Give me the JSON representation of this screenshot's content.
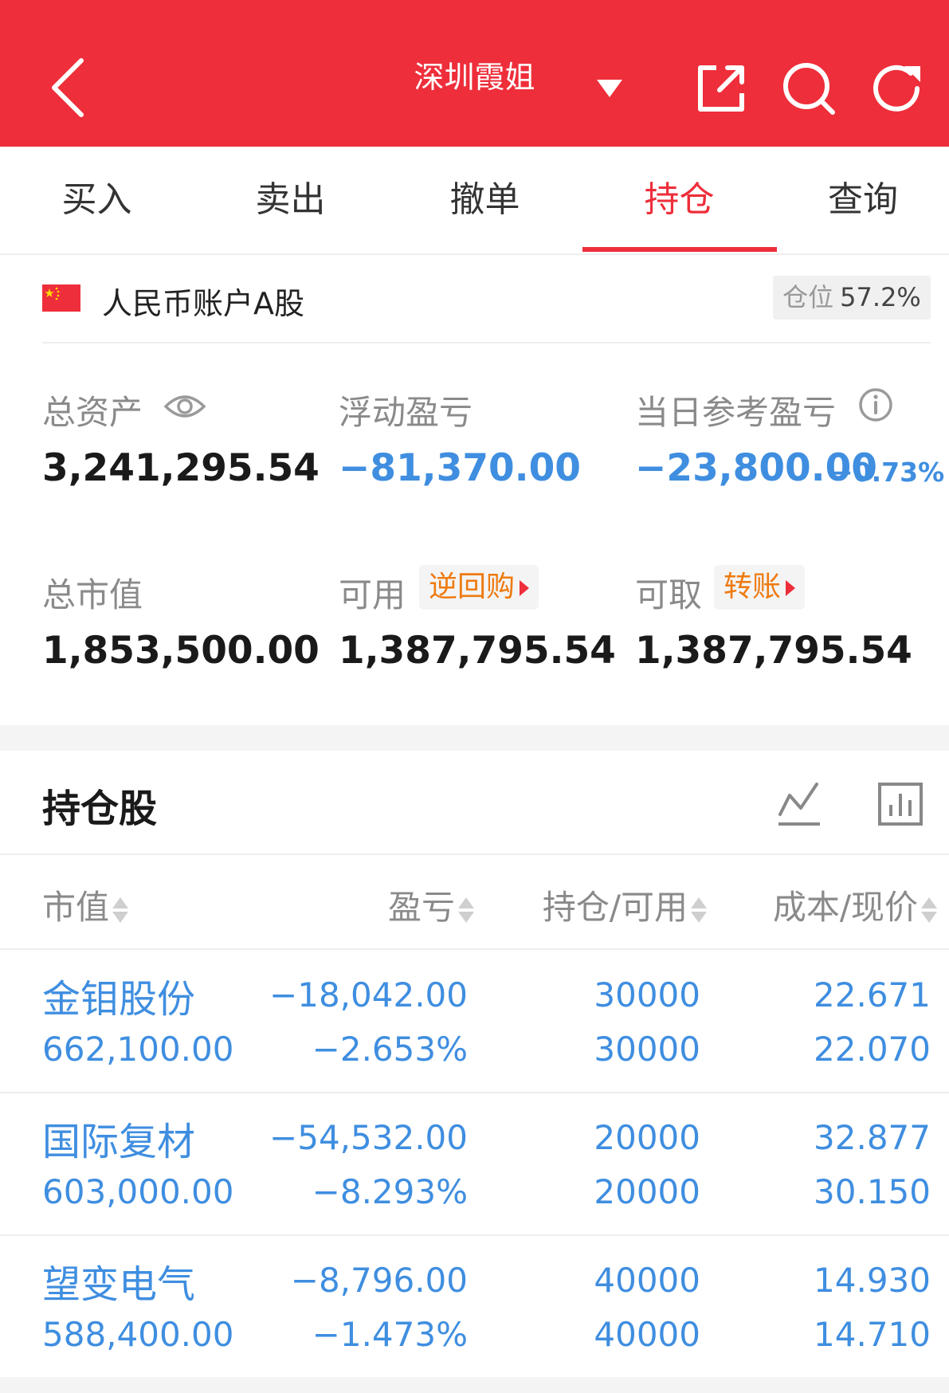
{
  "header": {
    "title": "深圳霞姐",
    "icons": [
      "back-icon",
      "dropdown-caret-icon",
      "share-icon",
      "search-icon",
      "refresh-icon"
    ]
  },
  "tabs": [
    {
      "label": "买入"
    },
    {
      "label": "卖出"
    },
    {
      "label": "撤单"
    },
    {
      "label": "持仓",
      "active": true
    },
    {
      "label": "查询"
    }
  ],
  "account": {
    "name": "人民币账户A股",
    "position_label": "仓位",
    "position_value": "57.2%"
  },
  "summary": {
    "total_assets_label": "总资产",
    "total_assets_value": "3,241,295.54",
    "float_pl_label": "浮动盈亏",
    "float_pl_value": "−81,370.00",
    "daily_pl_label": "当日参考盈亏",
    "daily_pl_value": "−23,800.00",
    "daily_pl_pct": "−0.73%",
    "market_value_label": "总市值",
    "market_value_value": "1,853,500.00",
    "available_label": "可用",
    "available_button": "逆回购",
    "available_value": "1,387,795.54",
    "withdrawable_label": "可取",
    "withdrawable_button": "转账",
    "withdrawable_value": "1,387,795.54"
  },
  "holdings": {
    "title": "持仓股",
    "columns": [
      "市值",
      "盈亏",
      "持仓/可用",
      "成本/现价"
    ],
    "rows": [
      {
        "name": "金钼股份",
        "market_value": "662,100.00",
        "pl": "−18,042.00",
        "pl_pct": "−2.653%",
        "position": "30000",
        "available": "30000",
        "cost": "22.671",
        "price": "22.070"
      },
      {
        "name": "国际复材",
        "market_value": "603,000.00",
        "pl": "−54,532.00",
        "pl_pct": "−8.293%",
        "position": "20000",
        "available": "20000",
        "cost": "32.877",
        "price": "30.150"
      },
      {
        "name": "望变电气",
        "market_value": "588,400.00",
        "pl": "−8,796.00",
        "pl_pct": "−1.473%",
        "position": "40000",
        "available": "40000",
        "cost": "14.930",
        "price": "14.710"
      }
    ]
  },
  "colors": {
    "brand_red": "#ee2e3a",
    "loss_blue": "#3f8ee0",
    "button_orange": "#ee7a10"
  }
}
